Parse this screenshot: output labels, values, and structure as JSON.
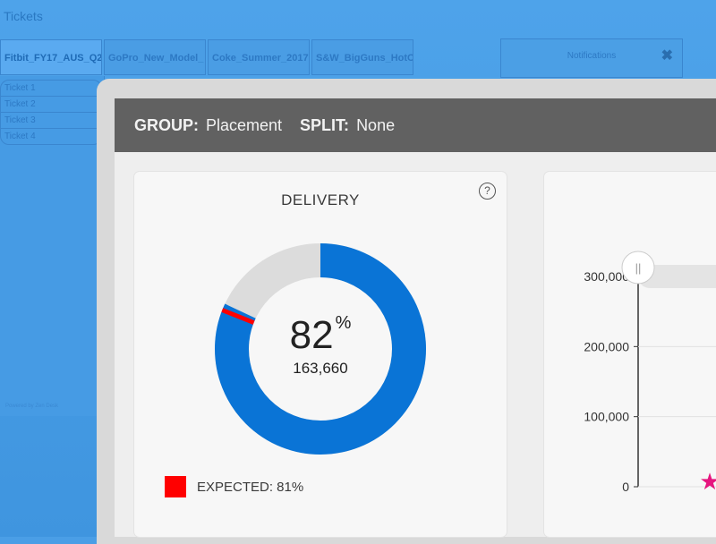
{
  "background_app": {
    "title": "Tickets",
    "tabs": [
      "Fitbit_FY17_AUS_Q2",
      "GoPro_New_Model_",
      "Coke_Summer_2017",
      "S&W_BigGuns_HotC"
    ],
    "notifications_label": "Notifications",
    "close_glyph": "✖",
    "tickets": [
      "Ticket 1",
      "Ticket 2",
      "Ticket 3",
      "Ticket 4"
    ],
    "powered_by": "Powered by Zen Desk"
  },
  "toolbar": {
    "group_key": "GROUP:",
    "group_value": "Placement",
    "split_key": "SPLIT:",
    "split_value": "None"
  },
  "delivery_card": {
    "title": "DELIVERY",
    "help_glyph": "?",
    "percent": "82",
    "percent_sign": "%",
    "count": "163,660",
    "legend_label": "EXPECTED: 81%",
    "delivered_fraction": 0.82,
    "expected_fraction": 0.81,
    "colors": {
      "delivered": "#0a74d6",
      "remaining": "#dcdcdc",
      "expected": "#ff0000"
    }
  },
  "chart_data": {
    "type": "line",
    "title": "",
    "xlabel": "",
    "ylabel": "",
    "ylim": [
      0,
      300000
    ],
    "y_ticks": [
      "300,000",
      "200,000",
      "100,000",
      "0"
    ],
    "marker_color": "#e6157f"
  }
}
